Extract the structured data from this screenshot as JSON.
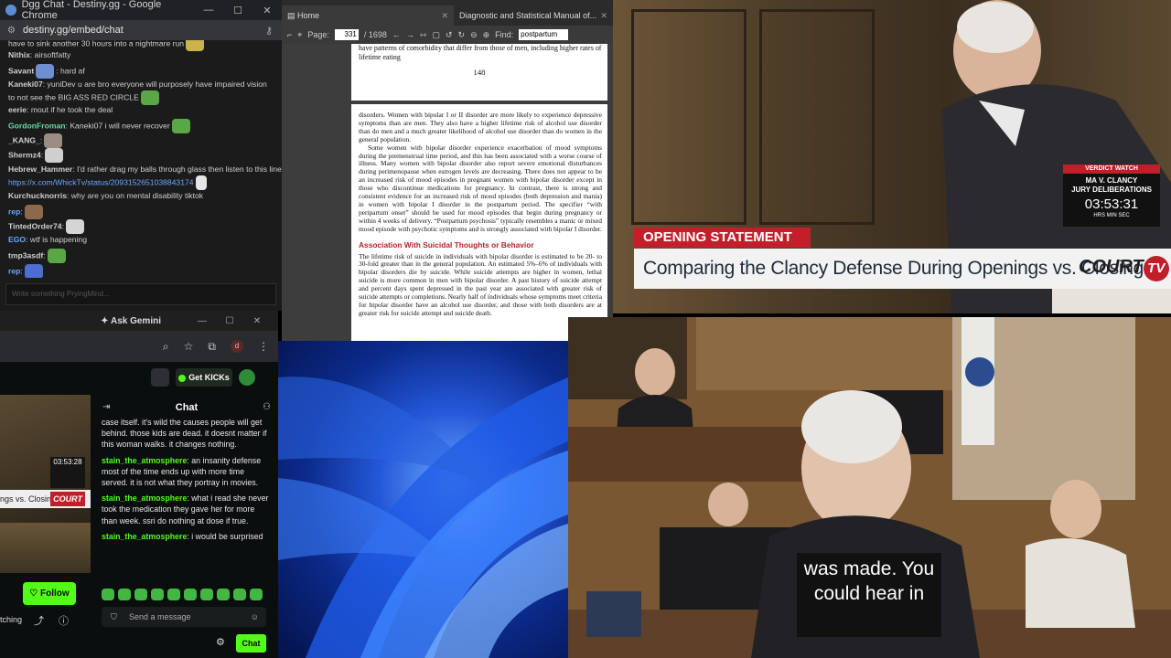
{
  "dgg": {
    "title": "Dgg Chat - Destiny.gg - Google Chrome",
    "url": "destiny.gg/embed/chat",
    "messages": [
      {
        "user": "",
        "text": "have to sink another 30 hours into a nightmare run"
      },
      {
        "user": "Nithix",
        "text": ": airsoftfatty"
      },
      {
        "user": "Savant",
        "text": ":  hard af"
      },
      {
        "user": "Kaneki07",
        "text": ": yuniDev u are  bro everyone will purposely have impaired vision"
      },
      {
        "user": "",
        "text": "to not see the BIG ASS RED CIRCLE"
      },
      {
        "user": "eerie",
        "text": ": mout if he took the  deal"
      },
      {
        "user": "GordonFroman",
        "text": ": Kaneki07 i will never recover"
      },
      {
        "user": "_KANG_",
        "text": ":"
      },
      {
        "user": "Shermz4",
        "text": ":"
      },
      {
        "user": "Hebrew_Hammer",
        "text": ": I'd rather drag my balls through glass then listen to this lineup"
      },
      {
        "user": "",
        "text": "https://x.com/WhickTv/status/2093152651038843174"
      },
      {
        "user": "Kurchucknorris",
        "text": ": why are you on mental disability tiktok"
      },
      {
        "user": "rep",
        "text": ":"
      },
      {
        "user": "TintedOrder74",
        "text": ":"
      },
      {
        "user": "EGO",
        "text": ": wtf is happening"
      },
      {
        "user": "tmp3asdf",
        "text": ":"
      },
      {
        "user": "rep",
        "text": ":"
      }
    ],
    "input_placeholder": "Write something PryingMind..."
  },
  "kick": {
    "gemini_label": "Ask Gemini",
    "avatar_letter": "d",
    "get_kicks_label": "Get KICKs",
    "chat_title": "Chat",
    "video": {
      "banner_text": "ngs vs. Closings",
      "logo": "COURT",
      "timer": "03:53:28"
    },
    "follow_label": "Follow",
    "watching_label": "tching",
    "messages": [
      {
        "user": "",
        "text": "case itself. it's wild the causes people will get behind. those kids are dead. it doesnt matter if this woman walks. it changes nothing."
      },
      {
        "user": "stain_the_atmosphere",
        "text": ": an insanity defense most of the time ends up with more time served. it is not what they portray in movies."
      },
      {
        "user": "stain_the_atmosphere",
        "text": ": what i read she never took the medication they gave her for more than week. ssri do nothing at dose if true."
      },
      {
        "user": "stain_the_atmosphere",
        "text": ": i would be surprised"
      }
    ],
    "send_placeholder": "Send a message",
    "chat_button": "Chat"
  },
  "pdf": {
    "tab_home": "Home",
    "tab_doc": "Diagnostic and Statistical Manual of...",
    "page_label": "Page:",
    "page_value": "331",
    "page_total": "/ 1698",
    "find_label": "Find:",
    "find_value": "postpartum",
    "p1_text": "have patterns of comorbidity that differ from those of men, including higher rates of lifetime eating",
    "p1_pagenum": "148",
    "p2_para1": "disorders. Women with bipolar I or II disorder are more likely to experience depressive symptoms than are men. They also have a higher lifetime risk of alcohol use disorder than do men and a much greater likelihood of alcohol use disorder than do women in the general population.",
    "p2_para2": "Some women with bipolar disorder experience exacerbation of mood symptoms during the premenstrual time period, and this has been associated with a worse course of illness. Many women with bipolar disorder also report severe emotional disturbances during perimenopause when estrogen levels are decreasing. There does not appear to be an increased risk of mood episodes in pregnant women with bipolar disorder except in those who discontinue medications for pregnancy. In contrast, there is strong and consistent evidence for an increased risk of mood episodes (both depression and mania) in women with bipolar I disorder in the postpartum period. The specifier “with peripartum onset” should be used for mood episodes that begin during pregnancy or within 4 weeks of delivery. “Postpartum psychosis” typically resembles a manic or mixed mood episode with psychotic symptoms and is strongly associated with bipolar I disorder.",
    "p2_heading": "Association With Suicidal Thoughts or Behavior",
    "p2_para3": "The lifetime risk of suicide in individuals with bipolar disorder is estimated to be 20- to 30-fold greater than in the general population. An estimated 5%–6% of individuals with bipolar disorders die by suicide. While suicide attempts are higher in women, lethal suicide is more common in men with bipolar disorder. A past history of suicide attempt and percent days spent depressed in the past year are associated with greater risk of suicide attempts or completions. Nearly half of individuals whose symptoms meet criteria for bipolar disorder have an alcohol use disorder, and those with both disorders are at greater risk for suicide attempt and suicide death."
  },
  "courttv": {
    "opening_label": "OPENING STATEMENT",
    "headline": "Comparing the Clancy Defense During Openings vs. Closings",
    "logo_text": "COURT",
    "logo_tv": "TV",
    "verdict_watch": "VERDICT WATCH",
    "case_line1": "MA V. CLANCY",
    "case_line2": "JURY DELIBERATIONS",
    "clock": "03:53:31",
    "clock_units": "HRS    MIN    SEC"
  },
  "court_caption": "was made. You could hear in"
}
